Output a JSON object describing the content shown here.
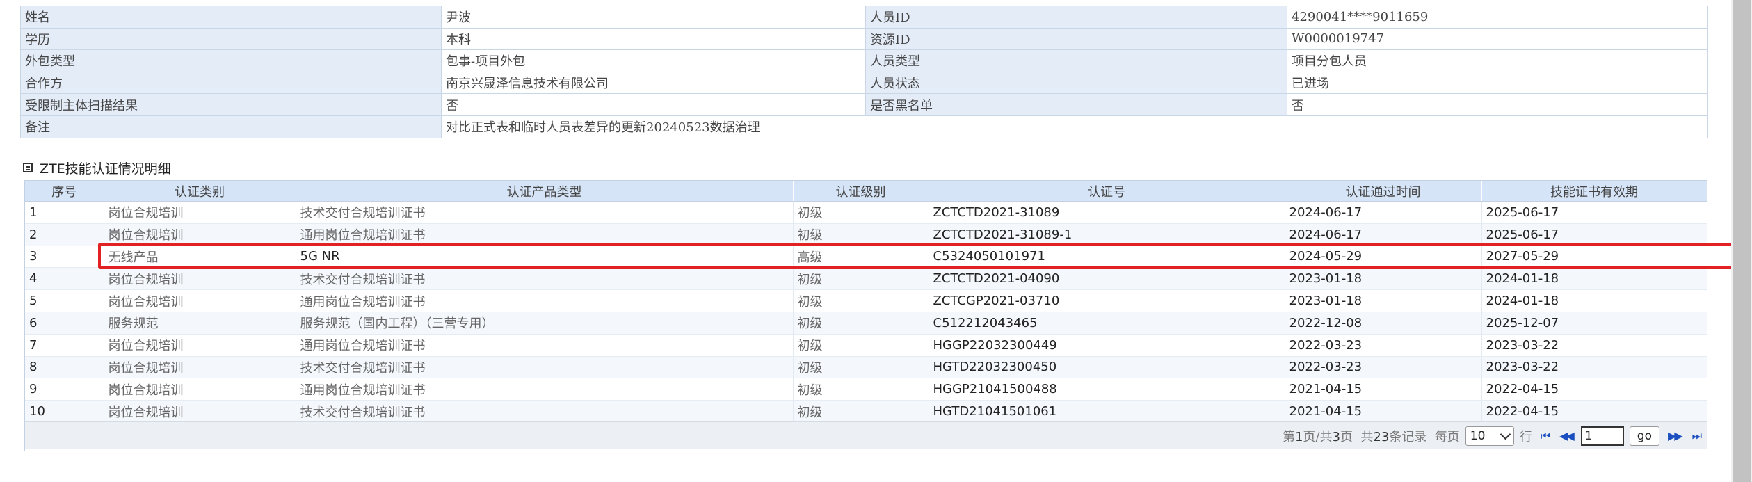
{
  "info_rows": [
    {
      "label1": "姓名",
      "value1": "尹波",
      "label2": "人员ID",
      "value2": "4290041****9011659"
    },
    {
      "label1": "学历",
      "value1": "本科",
      "label2": "资源ID",
      "value2": "W0000019747"
    },
    {
      "label1": "外包类型",
      "value1": "包事-项目外包",
      "label2": "人员类型",
      "value2": "项目分包人员"
    },
    {
      "label1": "合作方",
      "value1": "南京兴晟泽信息技术有限公司",
      "label2": "人员状态",
      "value2": "已进场"
    },
    {
      "label1": "受限制主体扫描结果",
      "value1": "否",
      "label2": "是否黑名单",
      "value2": "否"
    },
    {
      "label1": "备注",
      "value1": "对比正式表和临时人员表差异的更新20240523数据治理"
    }
  ],
  "section": {
    "title_latin": "ZTE",
    "title_cn": "技能认证情况明细"
  },
  "grid": {
    "headers": [
      "序号",
      "认证类别",
      "认证产品类型",
      "认证级别",
      "认证号",
      "认证通过时间",
      "技能证书有效期"
    ],
    "rows": [
      [
        "1",
        "岗位合规培训",
        "技术交付合规培训证书",
        "初级",
        "ZCTCTD2021-31089",
        "2024-06-17",
        "2025-06-17"
      ],
      [
        "2",
        "岗位合规培训",
        "通用岗位合规培训证书",
        "初级",
        "ZCTCTD2021-31089-1",
        "2024-06-17",
        "2025-06-17"
      ],
      [
        "3",
        "无线产品",
        "5G NR",
        "高级",
        "C5324050101971",
        "2024-05-29",
        "2027-05-29"
      ],
      [
        "4",
        "岗位合规培训",
        "技术交付合规培训证书",
        "初级",
        "ZCTCTD2021-04090",
        "2023-01-18",
        "2024-01-18"
      ],
      [
        "5",
        "岗位合规培训",
        "通用岗位合规培训证书",
        "初级",
        "ZCTCGP2021-03710",
        "2023-01-18",
        "2024-01-18"
      ],
      [
        "6",
        "服务规范",
        "服务规范（国内工程）（三营专用）",
        "初级",
        "C512212043465",
        "2022-12-08",
        "2025-12-07"
      ],
      [
        "7",
        "岗位合规培训",
        "通用岗位合规培训证书",
        "初级",
        "HGGP22032300449",
        "2022-03-23",
        "2023-03-22"
      ],
      [
        "8",
        "岗位合规培训",
        "技术交付合规培训证书",
        "初级",
        "HGTD22032300450",
        "2022-03-23",
        "2023-03-22"
      ],
      [
        "9",
        "岗位合规培训",
        "通用岗位合规培训证书",
        "初级",
        "HGGP21041500488",
        "2021-04-15",
        "2022-04-15"
      ],
      [
        "10",
        "岗位合规培训",
        "技术交付合规培训证书",
        "初级",
        "HGTD21041501061",
        "2021-04-15",
        "2022-04-15"
      ]
    ]
  },
  "pager": {
    "page_prefix": "第",
    "page_current": "1",
    "page_mid": "页/共",
    "page_total": "3",
    "page_suffix": "页",
    "records_prefix": "共",
    "records_total": "23",
    "records_suffix": "条记录",
    "per_page_label": "每页",
    "per_page_value": "10",
    "row_label": "行",
    "page_input_value": "1",
    "go_label": "go",
    "first_icon": "first-page-icon",
    "prev_icon": "prev-page-icon",
    "next_icon": "next-page-icon",
    "last_icon": "last-page-icon"
  },
  "colors": {
    "highlight": "#e22222",
    "label_bg": "#e4ecf8",
    "header_bg": "#d6e4f7",
    "nav_icon": "#1b4fbf"
  }
}
